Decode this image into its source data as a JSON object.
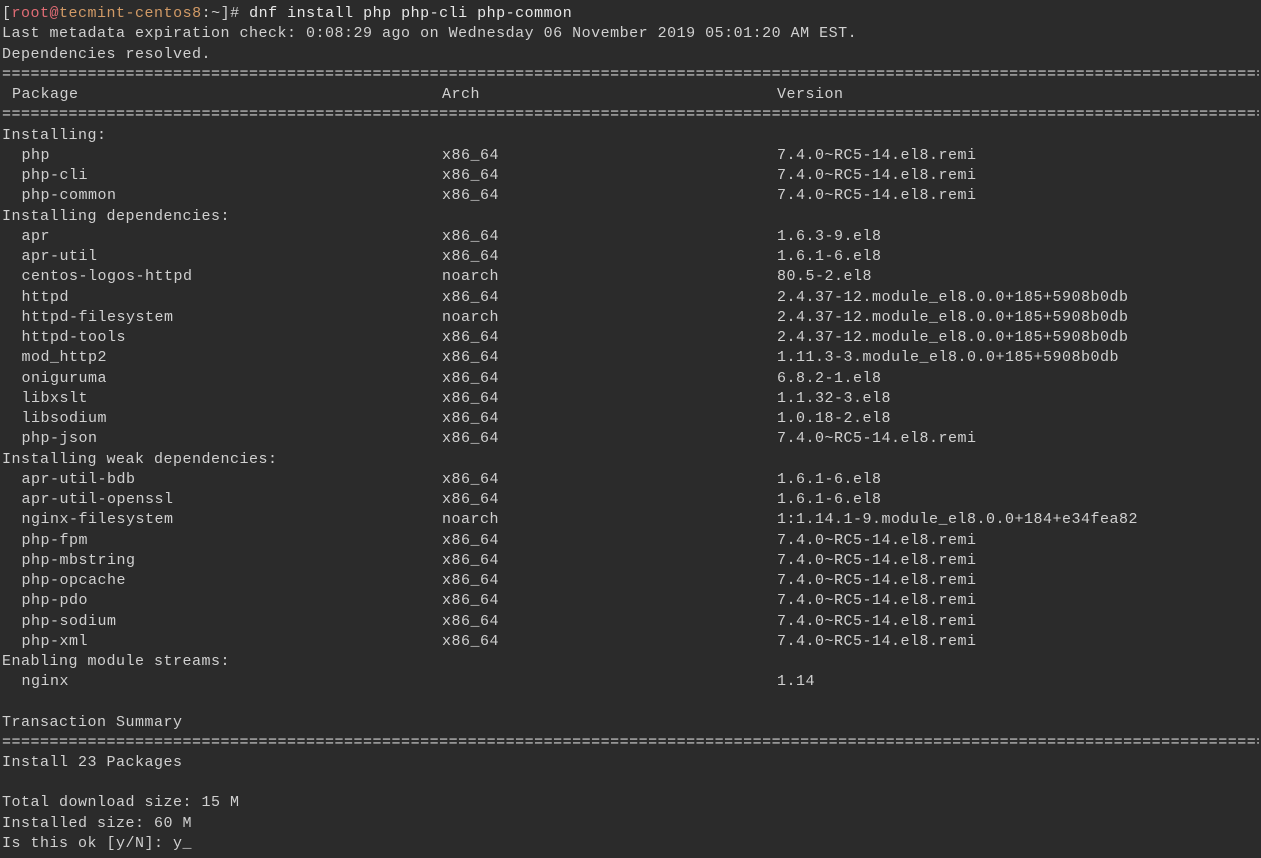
{
  "prompt": {
    "open_bracket": "[",
    "user": "root",
    "at": "@",
    "host": "tecmint-centos8",
    "colon": ":",
    "path": "~",
    "close_bracket": "]",
    "hash": "# "
  },
  "command": "dnf install php php-cli php-common",
  "meta_line": "Last metadata expiration check: 0:08:29 ago on Wednesday 06 November 2019 05:01:20 AM EST.",
  "deps_resolved": "Dependencies resolved.",
  "divider": "=========================================================================================================================================",
  "header": {
    "package": "Package",
    "arch": "Arch",
    "version": "Version"
  },
  "installing_label": "Installing:",
  "installing": [
    {
      "pkg": "php",
      "arch": "x86_64",
      "ver": "7.4.0~RC5-14.el8.remi"
    },
    {
      "pkg": "php-cli",
      "arch": "x86_64",
      "ver": "7.4.0~RC5-14.el8.remi"
    },
    {
      "pkg": "php-common",
      "arch": "x86_64",
      "ver": "7.4.0~RC5-14.el8.remi"
    }
  ],
  "deps_label": "Installing dependencies:",
  "deps": [
    {
      "pkg": "apr",
      "arch": "x86_64",
      "ver": "1.6.3-9.el8"
    },
    {
      "pkg": "apr-util",
      "arch": "x86_64",
      "ver": "1.6.1-6.el8"
    },
    {
      "pkg": "centos-logos-httpd",
      "arch": "noarch",
      "ver": "80.5-2.el8"
    },
    {
      "pkg": "httpd",
      "arch": "x86_64",
      "ver": "2.4.37-12.module_el8.0.0+185+5908b0db"
    },
    {
      "pkg": "httpd-filesystem",
      "arch": "noarch",
      "ver": "2.4.37-12.module_el8.0.0+185+5908b0db"
    },
    {
      "pkg": "httpd-tools",
      "arch": "x86_64",
      "ver": "2.4.37-12.module_el8.0.0+185+5908b0db"
    },
    {
      "pkg": "mod_http2",
      "arch": "x86_64",
      "ver": "1.11.3-3.module_el8.0.0+185+5908b0db"
    },
    {
      "pkg": "oniguruma",
      "arch": "x86_64",
      "ver": "6.8.2-1.el8"
    },
    {
      "pkg": "libxslt",
      "arch": "x86_64",
      "ver": "1.1.32-3.el8"
    },
    {
      "pkg": "libsodium",
      "arch": "x86_64",
      "ver": "1.0.18-2.el8"
    },
    {
      "pkg": "php-json",
      "arch": "x86_64",
      "ver": "7.4.0~RC5-14.el8.remi"
    }
  ],
  "weak_label": "Installing weak dependencies:",
  "weak": [
    {
      "pkg": "apr-util-bdb",
      "arch": "x86_64",
      "ver": "1.6.1-6.el8"
    },
    {
      "pkg": "apr-util-openssl",
      "arch": "x86_64",
      "ver": "1.6.1-6.el8"
    },
    {
      "pkg": "nginx-filesystem",
      "arch": "noarch",
      "ver": "1:1.14.1-9.module_el8.0.0+184+e34fea82"
    },
    {
      "pkg": "php-fpm",
      "arch": "x86_64",
      "ver": "7.4.0~RC5-14.el8.remi"
    },
    {
      "pkg": "php-mbstring",
      "arch": "x86_64",
      "ver": "7.4.0~RC5-14.el8.remi"
    },
    {
      "pkg": "php-opcache",
      "arch": "x86_64",
      "ver": "7.4.0~RC5-14.el8.remi"
    },
    {
      "pkg": "php-pdo",
      "arch": "x86_64",
      "ver": "7.4.0~RC5-14.el8.remi"
    },
    {
      "pkg": "php-sodium",
      "arch": "x86_64",
      "ver": "7.4.0~RC5-14.el8.remi"
    },
    {
      "pkg": "php-xml",
      "arch": "x86_64",
      "ver": "7.4.0~RC5-14.el8.remi"
    }
  ],
  "streams_label": "Enabling module streams:",
  "streams": [
    {
      "pkg": "nginx",
      "arch": "",
      "ver": "1.14"
    }
  ],
  "summary_label": "Transaction Summary",
  "install_count": "Install  23 Packages",
  "download_size": "Total download size: 15 M",
  "installed_size": "Installed size: 60 M",
  "confirm_prompt": "Is this ok [y/N]: ",
  "confirm_input": "y",
  "cursor": "_"
}
